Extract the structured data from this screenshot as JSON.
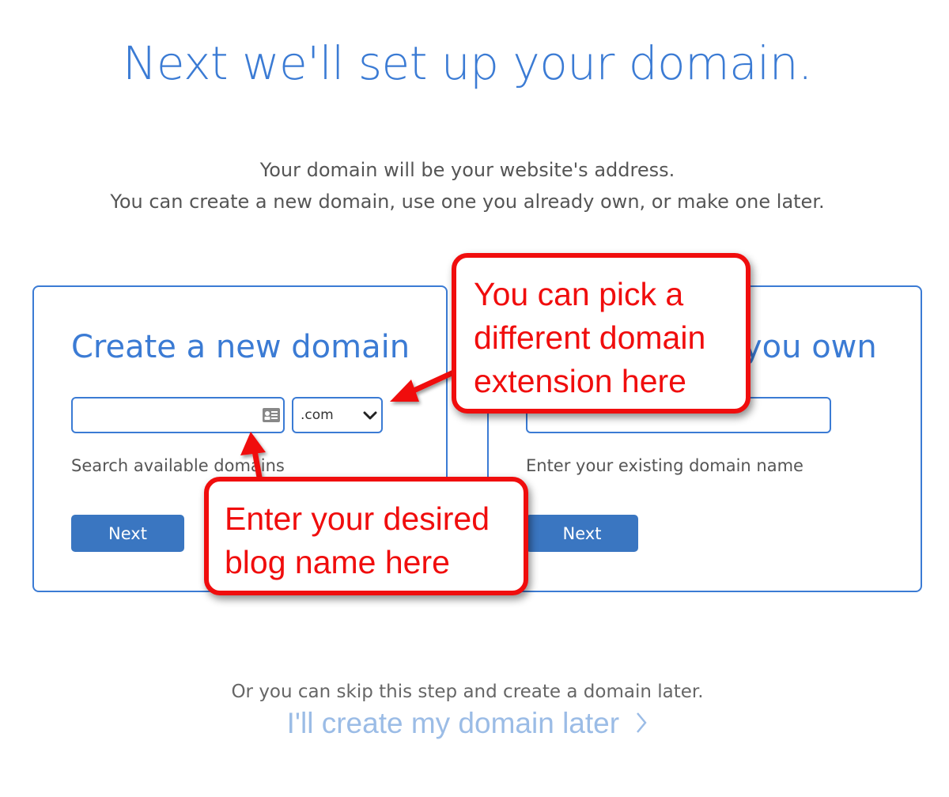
{
  "header": {
    "title": "Next we'll set up your domain.",
    "subtitle_line1": "Your domain will be your website's address.",
    "subtitle_line2": "You can create a new domain, use one you already own, or make one later."
  },
  "new_domain_card": {
    "title": "Create a new domain",
    "input_value": "",
    "tld_selected": ".com",
    "helper_text": "Search available domains",
    "button_label": "Next"
  },
  "existing_domain_card": {
    "title_visible_fragment": "you own",
    "input_value": "",
    "helper_text": "Enter your existing domain name",
    "button_label": "Next"
  },
  "callouts": {
    "tld_note_line1": "You can pick a",
    "tld_note_line2": "different domain",
    "tld_note_line3": "extension here",
    "name_note_line1": "Enter your desired",
    "name_note_line2": "blog name here"
  },
  "footer": {
    "skip_text": "Or you can skip this step and create a domain later.",
    "skip_link": "I'll create my domain later"
  },
  "colors": {
    "primary_blue": "#3b7bd4",
    "button_blue": "#3a76c1",
    "callout_red": "#f00d0d",
    "link_light_blue": "#9bbce6"
  },
  "icons": [
    "contact-card-icon",
    "chevron-down-icon",
    "chevron-right-icon"
  ]
}
